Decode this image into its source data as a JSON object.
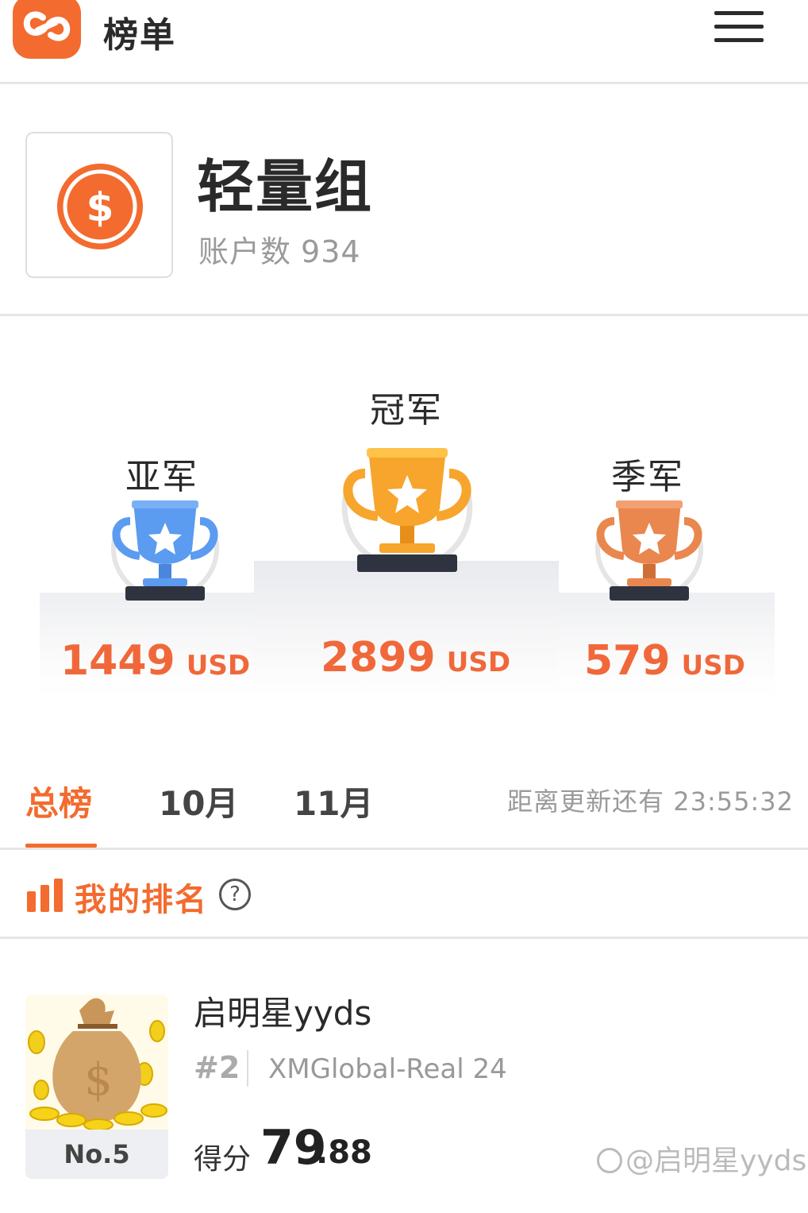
{
  "header": {
    "title": "榜单",
    "logo_icon": "link-loop-logo",
    "menu_icon": "hamburger-menu-icon",
    "brand_color": "#f36b2e"
  },
  "group": {
    "name": "轻量组",
    "account_label": "账户数",
    "account_count": "934",
    "icon": "dollar-coin-icon"
  },
  "podium": {
    "first": {
      "label": "冠军",
      "amount": "2899",
      "currency": "USD",
      "trophy_color": "#f7a52c"
    },
    "second": {
      "label": "亚军",
      "amount": "1449",
      "currency": "USD",
      "trophy_color": "#5b9bf0"
    },
    "third": {
      "label": "季军",
      "amount": "579",
      "currency": "USD",
      "trophy_color": "#e9874e"
    }
  },
  "tabs": {
    "items": [
      "总榜",
      "10月",
      "11月"
    ],
    "active_index": 0,
    "countdown_label": "距离更新还有",
    "countdown_value": "23:55:32"
  },
  "my_rank": {
    "title": "我的排名",
    "help": "?"
  },
  "entry": {
    "rank_badge": "No.5",
    "name": "启明星yyds",
    "position": "#2",
    "server": "XMGlobal-Real 24",
    "score_label": "得分",
    "score_int": "79",
    "score_dec": ".88"
  },
  "watermark": "@启明星yyds"
}
